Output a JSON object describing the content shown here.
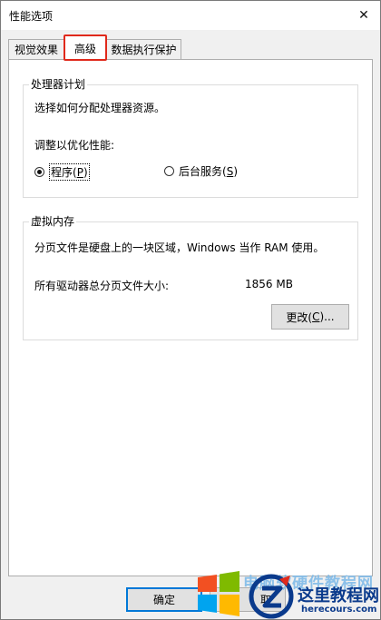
{
  "window": {
    "title": "性能选项",
    "close_glyph": "✕"
  },
  "tabs": [
    {
      "label": "视觉效果",
      "active": false
    },
    {
      "label": "高级",
      "active": true
    },
    {
      "label": "数据执行保护",
      "active": false
    }
  ],
  "processor": {
    "legend": "处理器计划",
    "description": "选择如何分配处理器资源。",
    "adjust_label": "调整以优化性能:",
    "programs": {
      "label_main": "程序(",
      "accelerator": "P",
      "label_end": ")",
      "checked": true
    },
    "services": {
      "label_main": "后台服务(",
      "accelerator": "S",
      "label_end": ")",
      "checked": false
    }
  },
  "virtual_memory": {
    "legend": "虚拟内存",
    "description": "分页文件是硬盘上的一块区域，Windows 当作 RAM 使用。",
    "total_label": "所有驱动器总分页文件大小:",
    "total_value": "1856 MB",
    "change_button": {
      "label_main": "更改(",
      "accelerator": "C",
      "label_end": ")..."
    }
  },
  "footer": {
    "ok_label": "确定",
    "cancel_label_visible": "取"
  },
  "watermark": {
    "top_text": "电脑软硬件教程网",
    "brand": "这里教程网",
    "url": "herecours.com",
    "colors": {
      "red": "#f25022",
      "green": "#7fba00",
      "blue": "#00a4ef",
      "yellow": "#ffb900",
      "brand": "#0a3a8c"
    }
  },
  "colors": {
    "highlight": "#e0291b",
    "focus_border": "#0078d7"
  }
}
